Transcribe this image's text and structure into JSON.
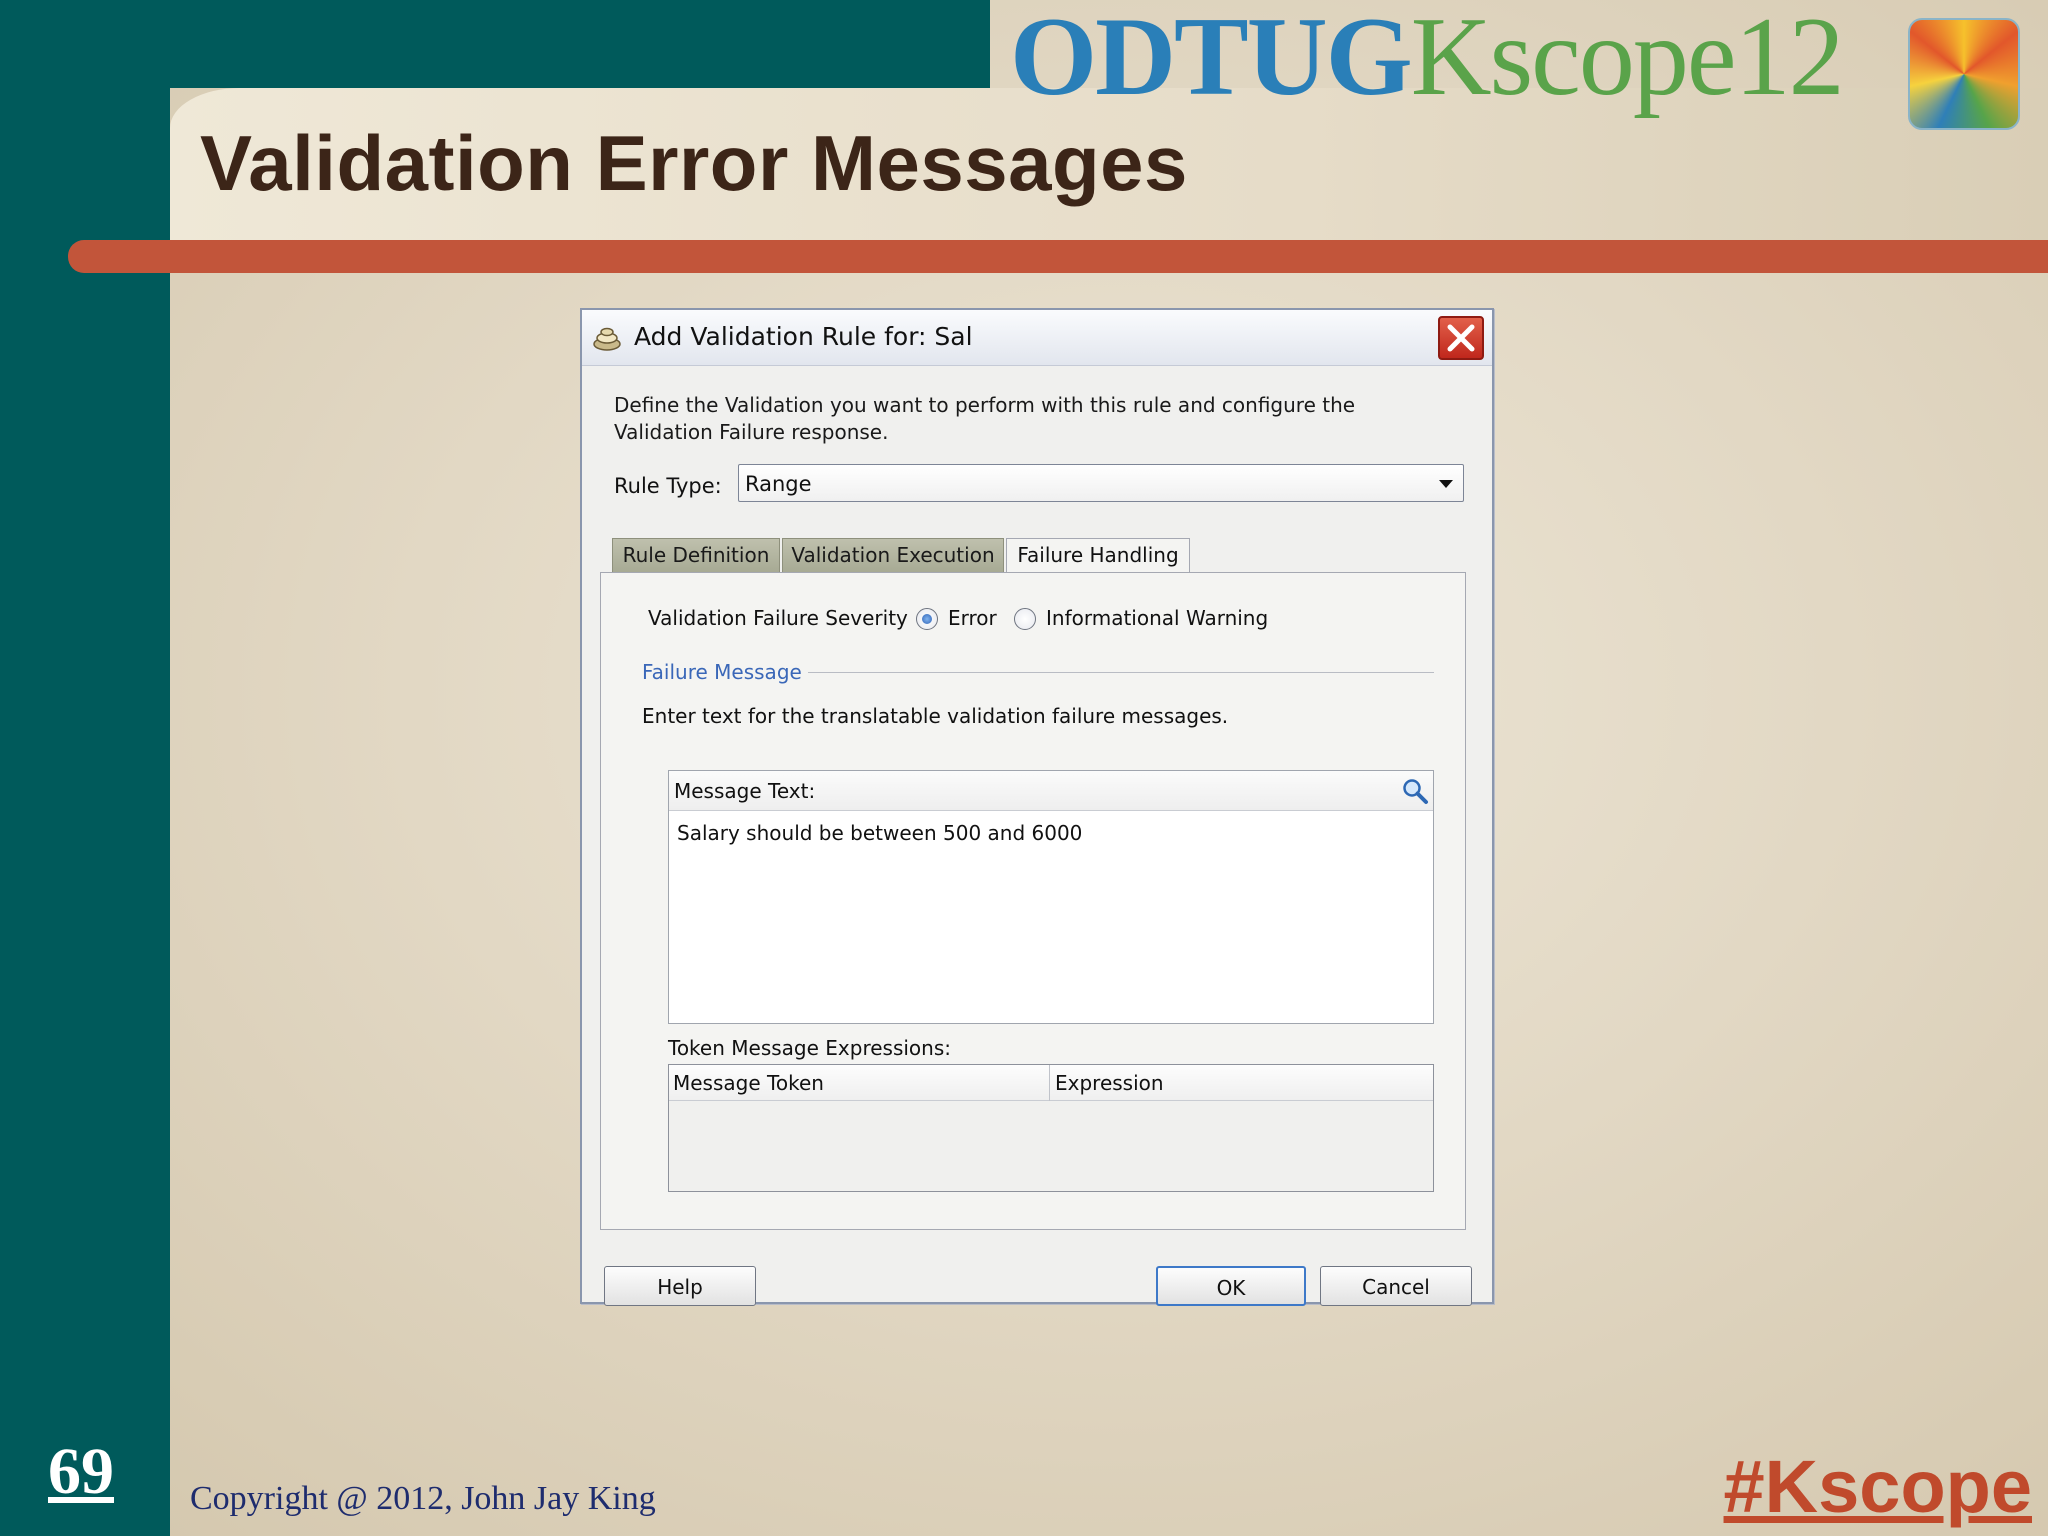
{
  "slide": {
    "title": "Validation Error Messages",
    "logo_odtug": "ODTUG",
    "logo_kscope": "Kscope12",
    "slide_number": "69",
    "copyright": "Copyright @ 2012, John Jay King",
    "hashtag": "#Kscope",
    "colors": {
      "band": "#005a5b",
      "red_bar": "#c2553a",
      "title": "#3c2518",
      "hashtag": "#c04a2c"
    }
  },
  "dialog": {
    "title": "Add Validation Rule for: Sal",
    "intro": "Define the Validation you want to perform with this rule and configure the Validation Failure response.",
    "rule_type": {
      "label": "Rule Type:",
      "value": "Range"
    },
    "tabs": [
      {
        "label": "Rule Definition",
        "active": false
      },
      {
        "label": "Validation Execution",
        "active": false
      },
      {
        "label": "Failure Handling",
        "active": true
      }
    ],
    "severity": {
      "label": "Validation Failure Severity",
      "options": [
        {
          "label": "Error",
          "selected": true
        },
        {
          "label": "Informational Warning",
          "selected": false
        }
      ]
    },
    "failure_message": {
      "header": "Failure Message",
      "description": "Enter text for the translatable validation failure messages.",
      "message_text_label": "Message Text:",
      "message_text": "Salary should be between 500 and 6000"
    },
    "token_expressions": {
      "label": "Token Message Expressions:",
      "columns": [
        "Message Token",
        "Expression"
      ]
    },
    "buttons": {
      "help": "Help",
      "ok": "OK",
      "cancel": "Cancel"
    },
    "icons": {
      "app": "dialog-app-icon",
      "close": "close-icon",
      "search": "search-icon"
    }
  }
}
